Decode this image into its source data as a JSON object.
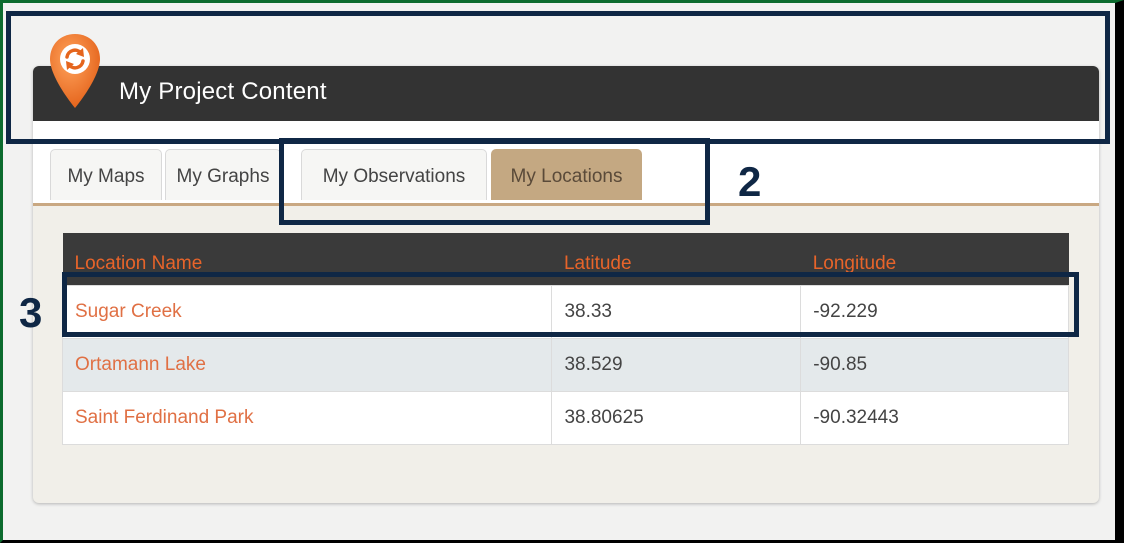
{
  "panel": {
    "title": "My Project Content"
  },
  "tabs": [
    {
      "label": "My Maps",
      "active": false
    },
    {
      "label": "My Graphs",
      "active": false
    },
    {
      "label": "My Observations",
      "active": false
    },
    {
      "label": "My Locations",
      "active": true
    }
  ],
  "table": {
    "headers": [
      "Location Name",
      "Latitude",
      "Longitude"
    ],
    "rows": [
      {
        "name": "Sugar Creek",
        "latitude": "38.33",
        "longitude": "-92.229"
      },
      {
        "name": "Ortamann Lake",
        "latitude": "38.529",
        "longitude": "-90.85"
      },
      {
        "name": "Saint Ferdinand Park",
        "latitude": "38.80625",
        "longitude": "-90.32443"
      }
    ]
  },
  "annotations": {
    "callout_2": "2",
    "callout_3": "3"
  },
  "icons": {
    "logo": "sync-map-pin-icon"
  },
  "colors": {
    "header_bg": "#333333",
    "accent": "#e8642a",
    "active_tab": "#c4a882",
    "callout": "#0f2745"
  }
}
